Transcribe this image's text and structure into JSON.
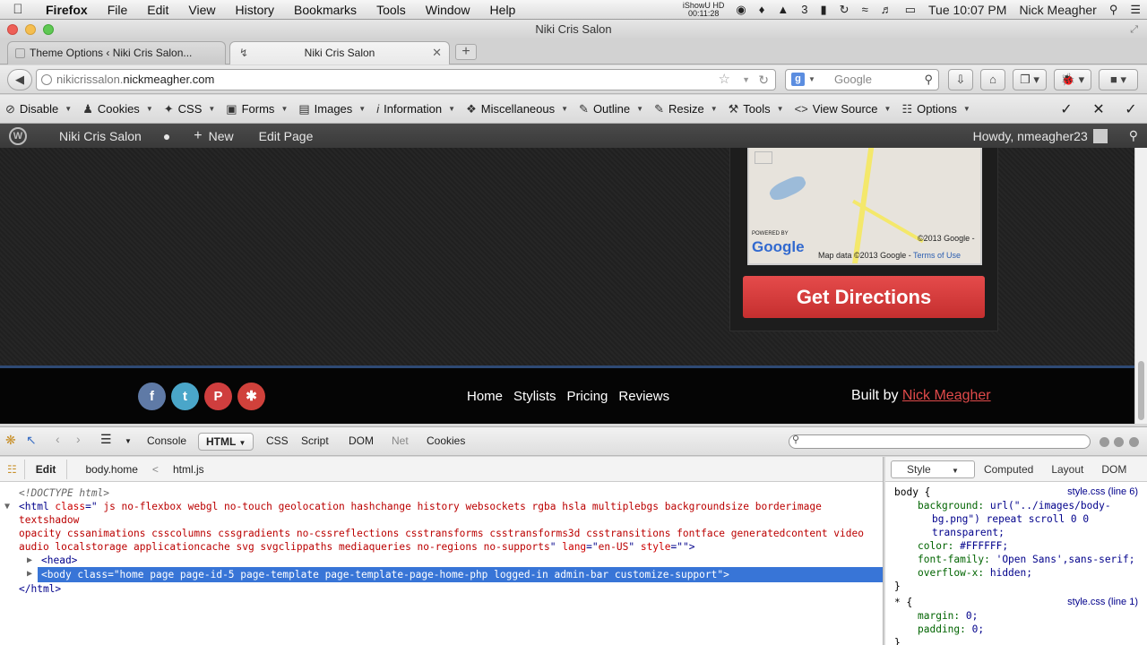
{
  "menubar": {
    "app": "Firefox",
    "items": [
      "File",
      "Edit",
      "View",
      "History",
      "Bookmarks",
      "Tools",
      "Window",
      "Help"
    ],
    "recorder_name": "iShowU HD",
    "recorder_time": "00:11:28",
    "badge_count": "3",
    "clock": "Tue 10:07 PM",
    "user": "Nick Meagher"
  },
  "window": {
    "title": "Niki Cris Salon"
  },
  "tabs": [
    {
      "label": "Theme Options ‹ Niki Cris Salon..."
    },
    {
      "label": "Niki Cris Salon"
    }
  ],
  "navbar": {
    "url_prefix": "nikicrissalon.",
    "url_domain": "nickmeagher.com",
    "search_placeholder": "Google"
  },
  "webdev_toolbar": {
    "items": [
      "Disable",
      "Cookies",
      "CSS",
      "Forms",
      "Images",
      "Information",
      "Miscellaneous",
      "Outline",
      "Resize",
      "Tools",
      "View Source",
      "Options"
    ]
  },
  "wp_admin_bar": {
    "site": "Niki Cris Salon",
    "new_label": "New",
    "edit_label": "Edit Page",
    "howdy": "Howdy, nmeagher23"
  },
  "page": {
    "map_powered": "POWERED BY",
    "map_google": "Google",
    "map_copyright": "©2013 Google -",
    "map_data": "Map data ©2013 Google -",
    "map_terms": "Terms of Use",
    "directions_button": "Get Directions",
    "footer_nav": [
      "Home",
      "Stylists",
      "Pricing",
      "Reviews"
    ],
    "built_by_prefix": "Built by",
    "built_by_name": "Nick Meagher"
  },
  "firebug": {
    "panels": [
      "Console",
      "HTML",
      "CSS",
      "Script",
      "DOM",
      "Net",
      "Cookies"
    ],
    "active_panel": "HTML",
    "edit_label": "Edit",
    "crumb_body": "body.home",
    "crumb_sep": "<",
    "crumb_html": "html.js",
    "side_tabs": [
      "Style",
      "Computed",
      "Layout",
      "DOM"
    ],
    "doctype": "<!DOCTYPE html>",
    "html_class_line1": " js no-flexbox webgl no-touch geolocation hashchange history websockets rgba hsla multiplebgs backgroundsize borderimage textshadow",
    "html_class_line2": "opacity cssanimations csscolumns cssgradients no-cssreflections csstransforms csstransforms3d csstransitions fontface generatedcontent video",
    "html_class_line3": "audio localstorage applicationcache svg svgclippaths mediaqueries no-regions no-supports",
    "html_lang": "en-US",
    "head_tag": "<head>",
    "body_tag": "<body class=\"home page page-id-5 page-template page-template-page-home-php logged-in admin-bar customize-support\">",
    "close_html": "</html>",
    "rule1_selector": "body {",
    "rule1_source": "style.css (line 6)",
    "rule1_decls": [
      {
        "p": "background:",
        "v": "url(\"../images/body-"
      },
      {
        "p": "",
        "v": "bg.png\") repeat scroll 0 0"
      },
      {
        "p": "",
        "v": "transparent;"
      },
      {
        "p": "color:",
        "v": "#FFFFFF;"
      },
      {
        "p": "font-family:",
        "v": "'Open Sans',sans-serif;"
      },
      {
        "p": "overflow-x:",
        "v": "hidden;"
      }
    ],
    "rule_close": "}",
    "rule2_selector": "* {",
    "rule2_source": "style.css (line 1)",
    "rule2_decls": [
      {
        "p": "margin:",
        "v": "0;"
      },
      {
        "p": "padding:",
        "v": "0;"
      }
    ]
  },
  "colors": {
    "accent_red": "#d9393b",
    "selection_blue": "#3875d7",
    "footer_border": "#2e4a75"
  }
}
